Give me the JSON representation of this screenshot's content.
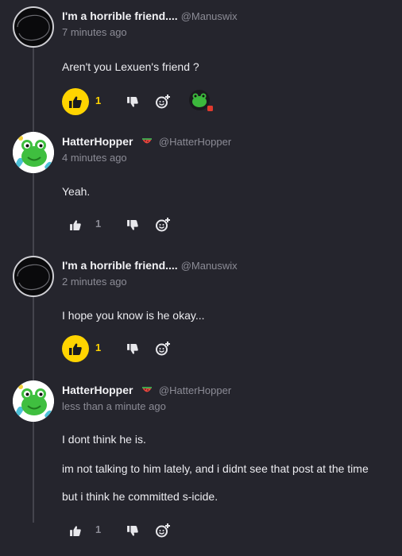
{
  "comments": [
    {
      "author": "I'm a horrible friend....",
      "handle": "@Manuswix",
      "time": "7 minutes ago",
      "lines": [
        "Aren't you Lexuen's friend ?"
      ],
      "likes": "1",
      "liked": true,
      "avatar": "dark-scribble-avatar",
      "reaction": "frog-reaction"
    },
    {
      "author": "HatterHopper",
      "handle": "@HatterHopper",
      "time": "4 minutes ago",
      "lines": [
        "Yeah."
      ],
      "likes": "1",
      "liked": false,
      "avatar": "frog-avatar",
      "badge": "watermelon-icon"
    },
    {
      "author": "I'm a horrible friend....",
      "handle": "@Manuswix",
      "time": "2 minutes ago",
      "lines": [
        "I hope you know is he okay..."
      ],
      "likes": "1",
      "liked": true,
      "avatar": "dark-scribble-avatar"
    },
    {
      "author": "HatterHopper",
      "handle": "@HatterHopper",
      "time": "less than a minute ago",
      "lines": [
        "I dont think he is.",
        "im not talking to him lately, and i didnt see that post at the time",
        "but i think he committed s-icide."
      ],
      "likes": "1",
      "liked": false,
      "avatar": "frog-avatar",
      "badge": "watermelon-icon"
    }
  ],
  "colors": {
    "background": "#25252d",
    "like_active": "#ffd400",
    "muted_text": "#8c8c96"
  }
}
